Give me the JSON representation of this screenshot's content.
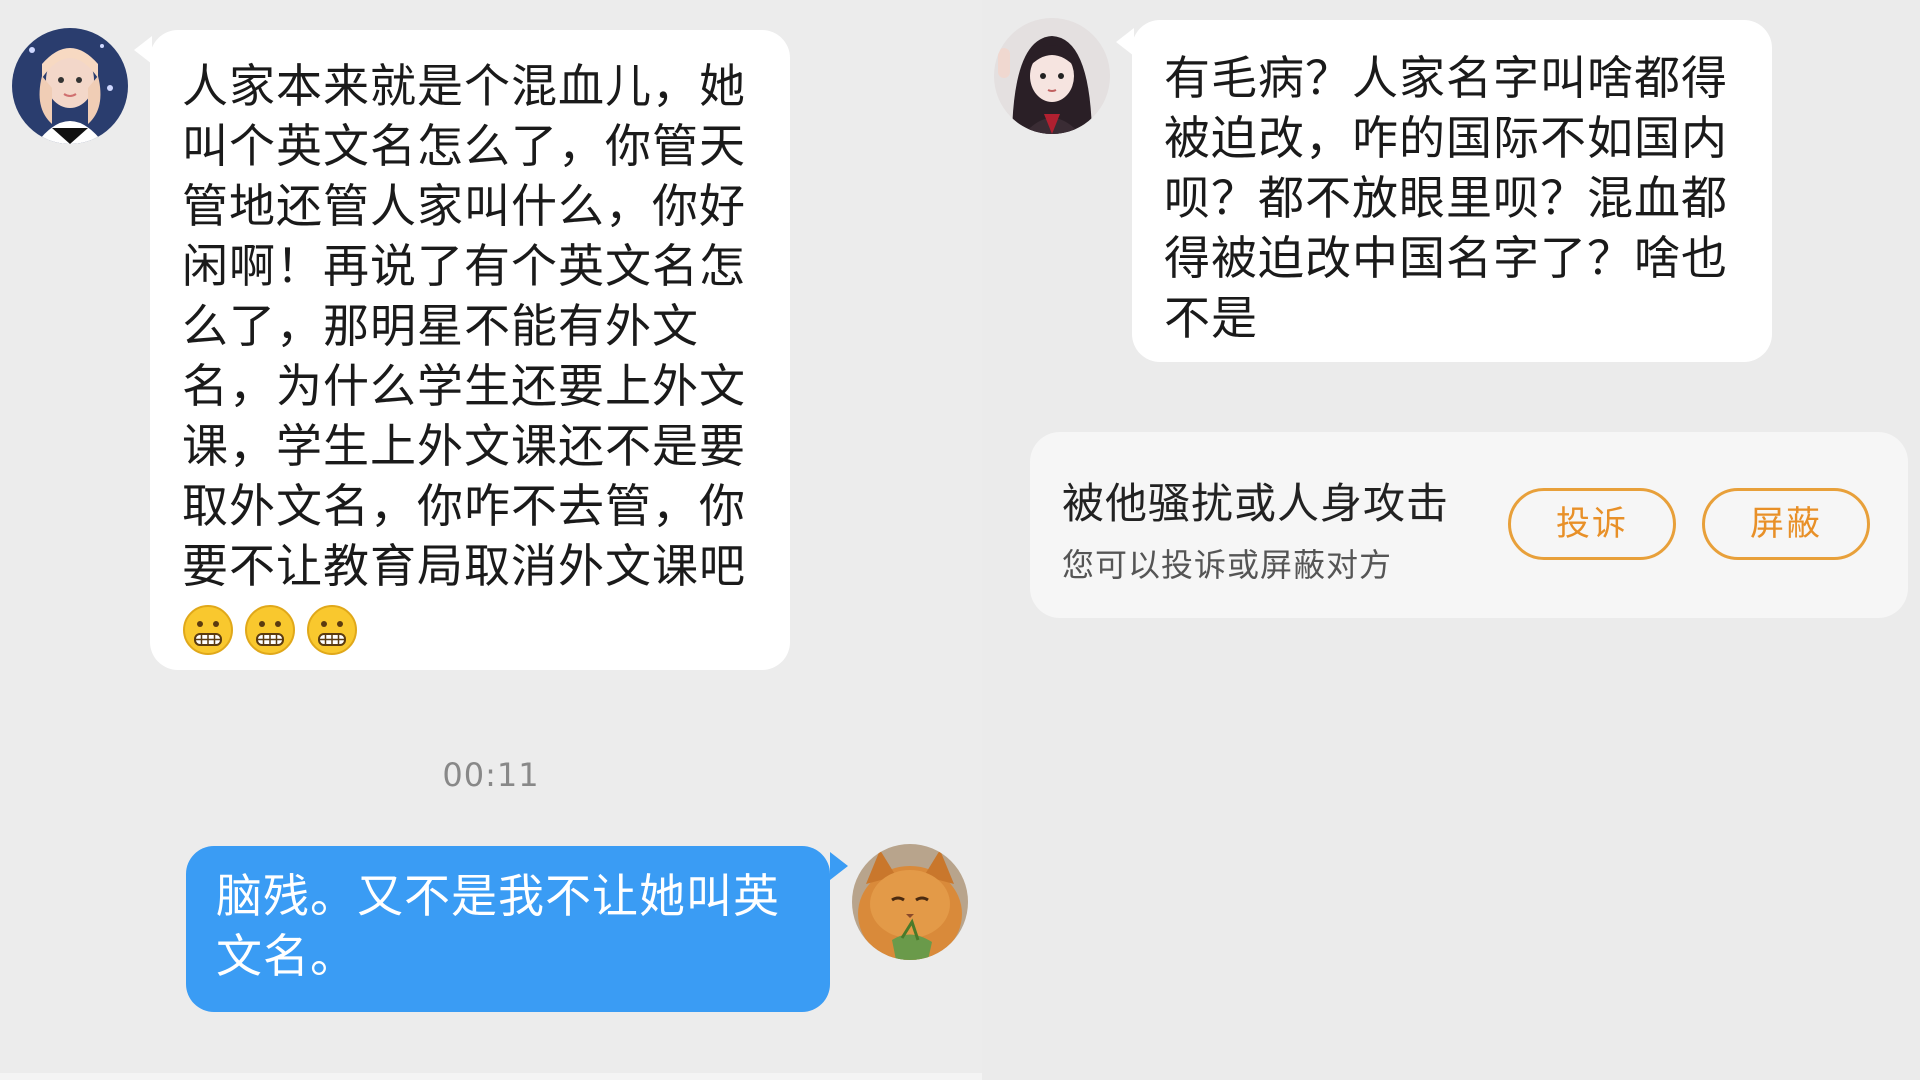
{
  "chat_left": {
    "incoming_message": {
      "text": "人家本来就是个混血儿，她\n叫个英文名怎么了，你管天\n管地还管人家叫什么，你好\n闲啊！再说了有个英文名怎\n么了，那明星不能有外文\n名，为什么学生还要上外文\n课，学生上外文课还不是要\n取外文名，你咋不去管，你\n要不让教育局取消外文课吧",
      "emoji": [
        "grimacing-face",
        "grimacing-face",
        "grimacing-face"
      ]
    },
    "timestamp": "00:11",
    "outgoing_message": {
      "text": "脑残。又不是我不让她叫英\n文名。"
    }
  },
  "chat_right": {
    "incoming_message": {
      "text": "有毛病？人家名字叫啥都得\n被迫改，咋的国际不如国内\n呗？都不放眼里呗？混血都\n得被迫改中国名字了？啥也\n不是"
    },
    "notice": {
      "title": "被他骚扰或人身攻击",
      "subtitle": "您可以投诉或屏蔽对方",
      "complain_label": "投诉",
      "block_label": "屏蔽"
    }
  },
  "colors": {
    "background": "#ececec",
    "bubble_white": "#ffffff",
    "bubble_blue": "#3a9cf4",
    "accent_orange": "#e89028"
  }
}
